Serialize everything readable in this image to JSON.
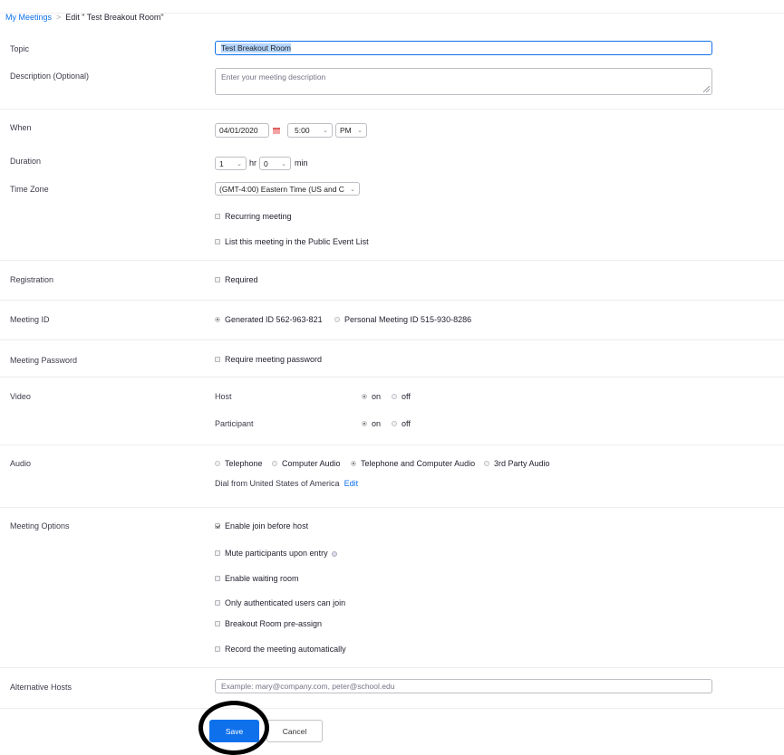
{
  "breadcrumb": {
    "parent": "My Meetings",
    "separator": ">",
    "current": "Edit \" Test Breakout Room\""
  },
  "topic": {
    "label": "Topic",
    "value": "Test Breakout Room"
  },
  "description": {
    "label": "Description (Optional)",
    "placeholder": "Enter your meeting description"
  },
  "when": {
    "label": "When",
    "date": "04/01/2020",
    "time": "5:00",
    "ampm": "PM"
  },
  "duration": {
    "label": "Duration",
    "hours": "1",
    "hr_label": "hr",
    "minutes": "0",
    "min_label": "min"
  },
  "timezone": {
    "label": "Time Zone",
    "value": "(GMT-4:00) Eastern Time (US and C"
  },
  "recurring": {
    "label": "Recurring meeting",
    "checked": false
  },
  "public_list": {
    "label": "List this meeting in the Public Event List",
    "checked": false
  },
  "registration": {
    "label": "Registration",
    "option": "Required",
    "checked": false
  },
  "meeting_id": {
    "label": "Meeting ID",
    "options": [
      {
        "label": "Generated ID 562-963-821",
        "selected": true
      },
      {
        "label": "Personal Meeting ID 515-930-8286",
        "selected": false
      }
    ]
  },
  "password": {
    "label": "Meeting Password",
    "option": "Require meeting password",
    "checked": false
  },
  "video": {
    "label": "Video",
    "host": {
      "label": "Host",
      "on": "on",
      "off": "off",
      "value": "on"
    },
    "participant": {
      "label": "Participant",
      "on": "on",
      "off": "off",
      "value": "on"
    }
  },
  "audio": {
    "label": "Audio",
    "options": [
      {
        "label": "Telephone",
        "selected": false
      },
      {
        "label": "Computer Audio",
        "selected": false
      },
      {
        "label": "Telephone and Computer Audio",
        "selected": true
      },
      {
        "label": "3rd Party Audio",
        "selected": false
      }
    ],
    "dial_from": "Dial from United States of America",
    "edit_link": "Edit"
  },
  "meeting_options": {
    "label": "Meeting Options",
    "items": [
      {
        "label": "Enable join before host",
        "checked": true
      },
      {
        "label": "Mute participants upon entry",
        "checked": false,
        "help_icon": "help-icon"
      },
      {
        "label": "Enable waiting room",
        "checked": false
      },
      {
        "label": "Only authenticated users can join",
        "checked": false
      },
      {
        "label": "Breakout Room pre-assign",
        "checked": false
      },
      {
        "label": "Record the meeting automatically",
        "checked": false
      }
    ]
  },
  "alternative_hosts": {
    "label": "Alternative Hosts",
    "placeholder": "Example: mary@company.com, peter@school.edu"
  },
  "actions": {
    "save": "Save",
    "cancel": "Cancel"
  },
  "colors": {
    "accent": "#0e71eb",
    "annotation_circle": "#000000"
  }
}
